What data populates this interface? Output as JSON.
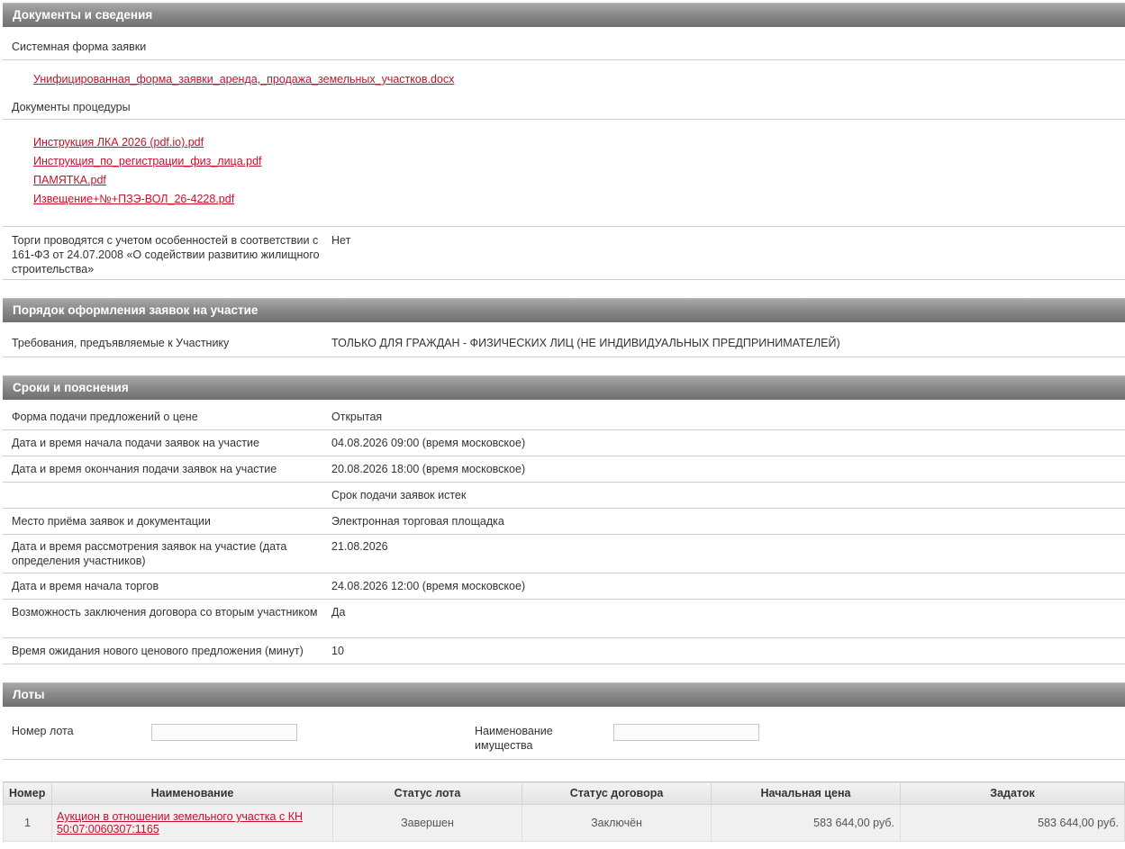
{
  "documents": {
    "header": "Документы и сведения",
    "system_form_label": "Системная форма заявки",
    "system_form_file": "Унифицированная_форма_заявки_аренда,_продажа_земельных_участков.docx",
    "procedure_docs_label": "Документы процедуры",
    "procedure_files": [
      "Инструкция ЛКА 2026 (pdf.io).pdf",
      "Инструкция_по_регистрации_физ_лица.pdf",
      "ПАМЯТКА.pdf",
      "Извещение+№+ПЗЭ-ВОЛ_26-4228.pdf"
    ],
    "fz161_label": "Торги проводятся с учетом особенностей в соответствии с 161-ФЗ от 24.07.2008 «О содействии развитию жилищного строительства»",
    "fz161_value": "Нет"
  },
  "order": {
    "header": "Порядок оформления заявок на участие",
    "requirements_label": "Требования, предъявляемые к Участнику",
    "requirements_value": "ТОЛЬКО ДЛЯ ГРАЖДАН - ФИЗИЧЕСКИХ ЛИЦ (НЕ ИНДИВИДУАЛЬНЫХ ПРЕДПРИНИМАТЕЛЕЙ)"
  },
  "terms": {
    "header": "Сроки и пояснения",
    "rows": [
      {
        "label": "Форма подачи предложений о цене",
        "value": "Открытая"
      },
      {
        "label": "Дата и время начала подачи заявок на участие",
        "value": "04.08.2026 09:00 (время московское)"
      },
      {
        "label": "Дата и время окончания подачи заявок на участие",
        "value": "20.08.2026 18:00 (время московское)"
      },
      {
        "label": "",
        "value": "Срок подачи заявок истек"
      },
      {
        "label": "Место приёма заявок и документации",
        "value": "Электронная торговая площадка"
      },
      {
        "label": "Дата и время рассмотрения заявок на участие (дата определения участников)",
        "value": "21.08.2026"
      },
      {
        "label": "Дата и время начала торгов",
        "value": "24.08.2026 12:00 (время московское)"
      },
      {
        "label": "Возможность заключения договора со вторым участником",
        "value": "Да"
      },
      {
        "label": "Время ожидания нового ценового предложения (минут)",
        "value": "10"
      }
    ]
  },
  "lots": {
    "header": "Лоты",
    "filter_lot_number_label": "Номер лота",
    "filter_lot_number_value": "",
    "filter_property_name_label": "Наименование имущества",
    "filter_property_name_value": "",
    "columns": [
      "Номер",
      "Наименование",
      "Статус лота",
      "Статус договора",
      "Начальная цена",
      "Задаток"
    ],
    "rows": [
      {
        "number": "1",
        "name": "Аукцион в отношении земельного участка с КН 50:07:0060307:1165",
        "lot_status": "Завершен",
        "contract_status": "Заключён",
        "start_price": "583 644,00 руб.",
        "deposit": "583 644,00 руб."
      }
    ]
  }
}
